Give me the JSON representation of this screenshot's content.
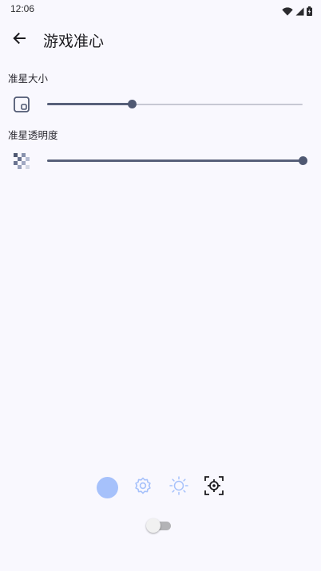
{
  "status_bar": {
    "time": "12:06",
    "icons": [
      "wifi-icon",
      "signal-icon",
      "battery-charging-icon"
    ]
  },
  "app_bar": {
    "back_icon": "arrow-left-icon",
    "title": "游戏准心"
  },
  "settings": [
    {
      "label": "准星大小",
      "icon": "crosshair-size-icon",
      "slider_value_percent": 33
    },
    {
      "label": "准星透明度",
      "icon": "transparency-checker-icon",
      "slider_value_percent": 100
    }
  ],
  "bottom_modes": [
    {
      "icon": "color-dot-icon",
      "color": "#a6c1fb",
      "selected": false
    },
    {
      "icon": "gear-icon",
      "color": "#a6c1fb",
      "selected": false
    },
    {
      "icon": "sun-icon",
      "color": "#a6c1fb",
      "selected": false
    },
    {
      "icon": "crosshair-icon",
      "color": "#1c1b1f",
      "selected": true
    }
  ],
  "toggle": {
    "on": false
  },
  "colors": {
    "background": "#f9f8fe",
    "accent": "#4f5872",
    "light_accent": "#a6c1fb",
    "track": "#c7c8d3"
  }
}
